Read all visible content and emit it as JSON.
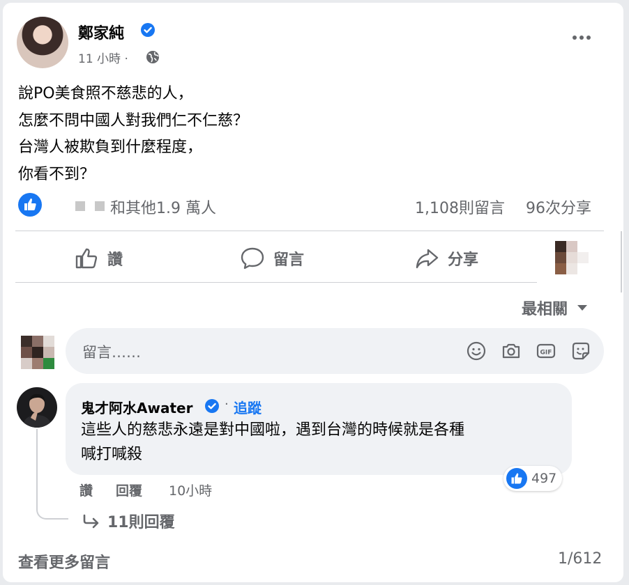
{
  "post": {
    "author": "鄭家純",
    "time": "11 小時",
    "dot": "·",
    "body_lines": [
      "說PO美食照不慈悲的人，",
      "怎麼不問中國人對我們仁不仁慈？",
      "台灣人被欺負到什麼程度，",
      "你看不到？"
    ]
  },
  "stats": {
    "reactions": "和其他1.9 萬人",
    "comments": "1,108則留言",
    "shares": "96次分享"
  },
  "actions": {
    "like": "讚",
    "comment": "留言",
    "share": "分享"
  },
  "sort": {
    "label": "最相關"
  },
  "composer": {
    "placeholder": "留言……"
  },
  "comment": {
    "author": "鬼才阿水Awater",
    "dot": "·",
    "follow": "追蹤",
    "text_lines": [
      "這些人的慈悲永遠是對中國啦，遇到台灣的時候就是各種",
      "喊打喊殺"
    ],
    "reaction_count": "497",
    "like": "讚",
    "reply": "回覆",
    "time": "10小時",
    "replies": "11則回覆"
  },
  "footer": {
    "more_comments": "查看更多留言",
    "pagination": "1/612"
  },
  "colors": {
    "accent": "#1877f2",
    "secondary_text": "#65676b",
    "bubble": "#f0f2f5"
  },
  "icons": [
    "verified-badge-icon",
    "globe-icon",
    "more-icon",
    "like-icon",
    "comment-icon",
    "share-icon",
    "chevron-down-icon",
    "emoji-icon",
    "camera-icon",
    "gif-icon",
    "sticker-icon",
    "reply-arrow-icon"
  ]
}
